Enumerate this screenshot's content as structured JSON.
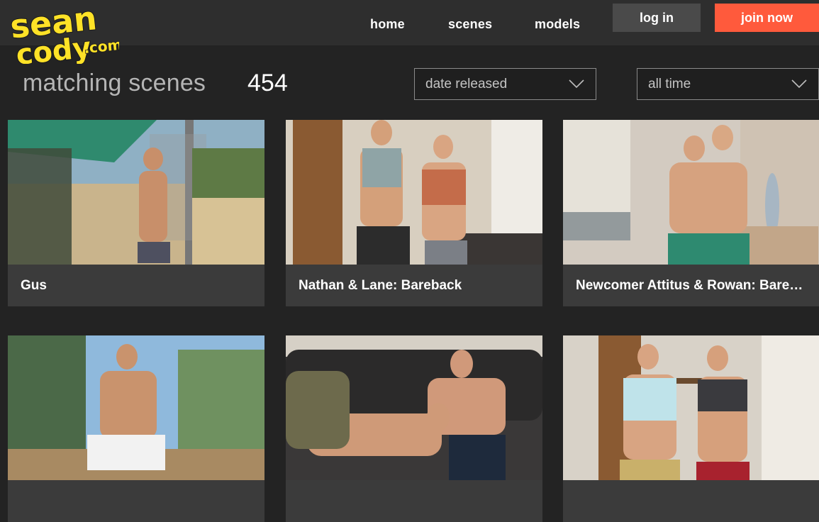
{
  "brand": {
    "line1": "sean",
    "line2": "cody",
    "suffix": ".com",
    "color": "#ffe227"
  },
  "nav": [
    {
      "label": "home"
    },
    {
      "label": "scenes"
    },
    {
      "label": "models"
    }
  ],
  "auth": {
    "login_label": "log in",
    "join_label": "join now",
    "join_color": "#ff5a3c"
  },
  "listing": {
    "heading": "matching scenes",
    "count": "454",
    "sort": {
      "selected": "date released"
    },
    "period": {
      "selected": "all time"
    }
  },
  "scenes": [
    {
      "title": "Gus"
    },
    {
      "title": "Nathan & Lane: Bareback"
    },
    {
      "title": "Newcomer Attitus & Rowan: Bareb..."
    },
    {
      "title": ""
    },
    {
      "title": ""
    },
    {
      "title": ""
    }
  ]
}
